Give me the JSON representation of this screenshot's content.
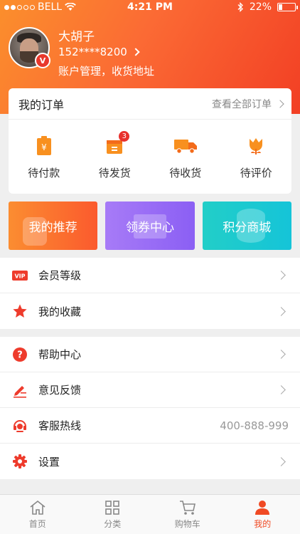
{
  "status_bar": {
    "carrier": "BELL",
    "time": "4:21 PM",
    "battery": "22%",
    "battery_level": 0.22
  },
  "profile": {
    "name": "大胡子",
    "phone": "152****8200",
    "account_link": "账户管理，收货地址",
    "badge": "V"
  },
  "orders": {
    "title": "我的订单",
    "view_all": "查看全部订单",
    "items": [
      {
        "label": "待付款",
        "icon": "payment-icon"
      },
      {
        "label": "待发货",
        "icon": "package-icon",
        "badge": "3"
      },
      {
        "label": "待收货",
        "icon": "truck-icon"
      },
      {
        "label": "待评价",
        "icon": "flower-icon"
      }
    ]
  },
  "promos": [
    {
      "label": "我的推荐",
      "color": "#fb6f2e"
    },
    {
      "label": "领券中心",
      "color": "#9a6cf5"
    },
    {
      "label": "积分商城",
      "color": "#1ccad0"
    }
  ],
  "list1": [
    {
      "label": "会员等级",
      "icon": "vip-icon"
    },
    {
      "label": "我的收藏",
      "icon": "star-icon"
    }
  ],
  "list2": [
    {
      "label": "帮助中心",
      "icon": "help-icon"
    },
    {
      "label": "意见反馈",
      "icon": "feedback-icon"
    },
    {
      "label": "客服热线",
      "icon": "headset-icon",
      "value": "400-888-999"
    },
    {
      "label": "设置",
      "icon": "gear-icon"
    }
  ],
  "tabs": [
    {
      "label": "首页",
      "icon": "home-icon"
    },
    {
      "label": "分类",
      "icon": "grid-icon"
    },
    {
      "label": "购物车",
      "icon": "cart-icon"
    },
    {
      "label": "我的",
      "icon": "user-icon",
      "active": true
    }
  ],
  "colors": {
    "accent": "#f04a24",
    "header_start": "#fb8f2c",
    "header_end": "#f23f24"
  }
}
